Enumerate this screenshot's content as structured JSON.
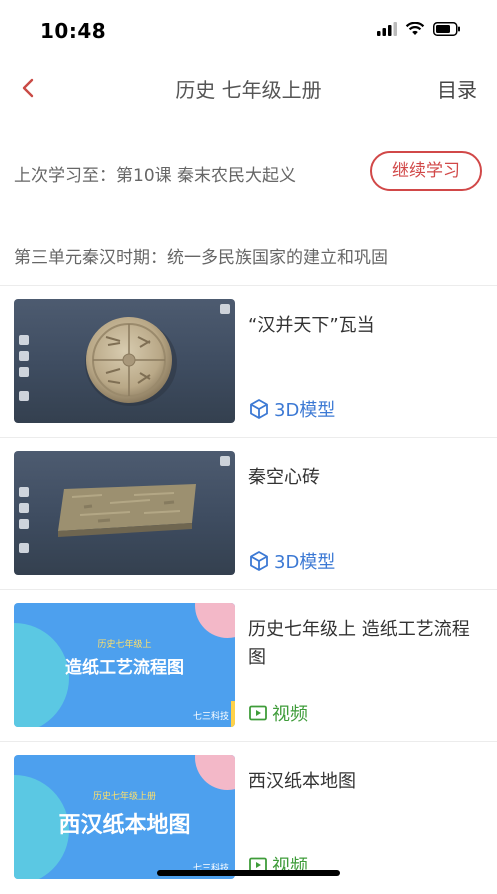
{
  "status_bar": {
    "time": "10:48"
  },
  "nav": {
    "title": "历史 七年级上册",
    "menu_label": "目录"
  },
  "progress": {
    "text": "上次学习至：第10课 秦末农民大起义",
    "continue_label": "继续学习"
  },
  "unit": {
    "title": "第三单元秦汉时期：统一多民族国家的建立和巩固"
  },
  "items": [
    {
      "title": "“汉并天下”瓦当",
      "type": "3D模型",
      "type_icon": "cube-icon"
    },
    {
      "title": "秦空心砖",
      "type": "3D模型",
      "type_icon": "cube-icon"
    },
    {
      "title": "历史七年级上 造纸工艺流程图",
      "type": "视频",
      "type_icon": "play-icon",
      "thumb": {
        "subtitle": "历史七年级上",
        "main": "造纸工艺流程图",
        "brand": "七三科技"
      }
    },
    {
      "title": "西汉纸本地图",
      "type": "视频",
      "type_icon": "play-icon",
      "thumb": {
        "subtitle": "历史七年级上册",
        "main": "西汉纸本地图",
        "brand": "七三科技"
      }
    }
  ],
  "colors": {
    "accent_red": "#d14848",
    "model_blue": "#3c79d4",
    "video_green": "#3f9c3a"
  }
}
